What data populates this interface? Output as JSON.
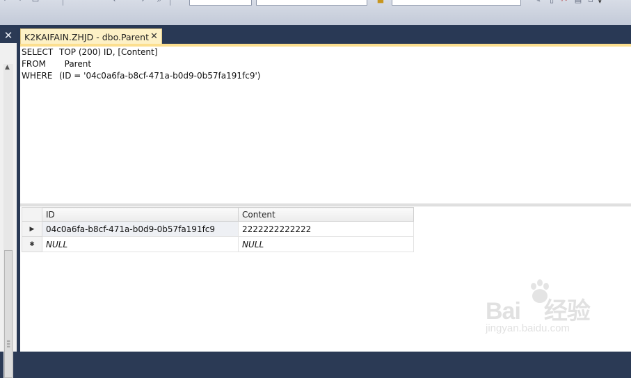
{
  "window": {
    "panel_close_glyph": "✕"
  },
  "document_tab": {
    "title": "K2KAIFAIN.ZHJD - dbo.Parent",
    "close_glyph": "✕"
  },
  "editor": {
    "lines": [
      {
        "keyword": "SELECT",
        "text": "TOP (200) ID, [Content]"
      },
      {
        "keyword": "FROM",
        "text": "  Parent"
      },
      {
        "keyword": "WHERE",
        "text": "(ID = '04c0a6fa-b8cf-471a-b0d9-0b57fa191fc9')"
      }
    ]
  },
  "results": {
    "columns": [
      "ID",
      "Content"
    ],
    "rows": [
      {
        "marker": "▶",
        "id": "04c0a6fa-b8cf-471a-b0d9-0b57fa191fc9",
        "content": "2222222222222"
      },
      {
        "marker": "✱",
        "id": "NULL",
        "content": "NULL"
      }
    ]
  },
  "icons": {
    "toolbar": [
      "undo-icon",
      "redo-icon",
      "find-icon",
      "folder-icon",
      "cut-icon",
      "dropdown-icon"
    ],
    "panel_close": "close-icon",
    "tab_close": "close-icon",
    "row_current": "row-pointer-icon",
    "row_new": "new-row-icon"
  },
  "watermark": {
    "logo_text": "Bai",
    "logo_text2": "经验",
    "url": "jingyan.baidu.com"
  },
  "colors": {
    "navy": "#293955",
    "tab_active": "#fdf1c6",
    "tab_strip": "#fcdf8f"
  }
}
